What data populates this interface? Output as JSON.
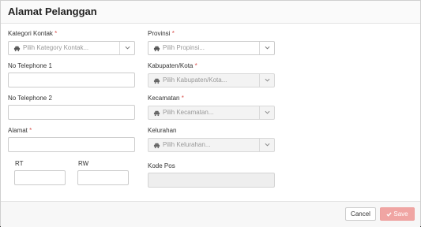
{
  "modal": {
    "title": "Alamat Pelanggan"
  },
  "form": {
    "kategori_kontak": {
      "label": "Kategori Kontak",
      "required": "*",
      "placeholder": "Pilih Kategory Kontak..."
    },
    "no_telephone_1": {
      "label": "No Telephone 1",
      "value": ""
    },
    "no_telephone_2": {
      "label": "No Telephone 2",
      "value": ""
    },
    "alamat": {
      "label": "Alamat",
      "required": "*",
      "value": ""
    },
    "rt": {
      "label": "RT",
      "value": ""
    },
    "rw": {
      "label": "RW",
      "value": ""
    },
    "provinsi": {
      "label": "Provinsi",
      "required": "*",
      "placeholder": "Pilih Propinsi..."
    },
    "kabupaten_kota": {
      "label": "Kabupaten/Kota",
      "required": "*",
      "placeholder": "Pilih Kabupaten/Kota..."
    },
    "kecamatan": {
      "label": "Kecamatan",
      "required": "*",
      "placeholder": "Pilih Kecamatan..."
    },
    "kelurahan": {
      "label": "Kelurahan",
      "placeholder": "Pilih Kelurahan..."
    },
    "kode_pos": {
      "label": "Kode Pos",
      "value": ""
    }
  },
  "footer": {
    "cancel_label": "Cancel",
    "save_label": "Save"
  },
  "icons": {
    "select_prefix": "car-icon",
    "select_caret": "chevron-down-icon",
    "save": "check-icon"
  },
  "colors": {
    "required": "#d9534f",
    "save_button": "#f0a5a3",
    "disabled_field": "#eeeeee"
  }
}
